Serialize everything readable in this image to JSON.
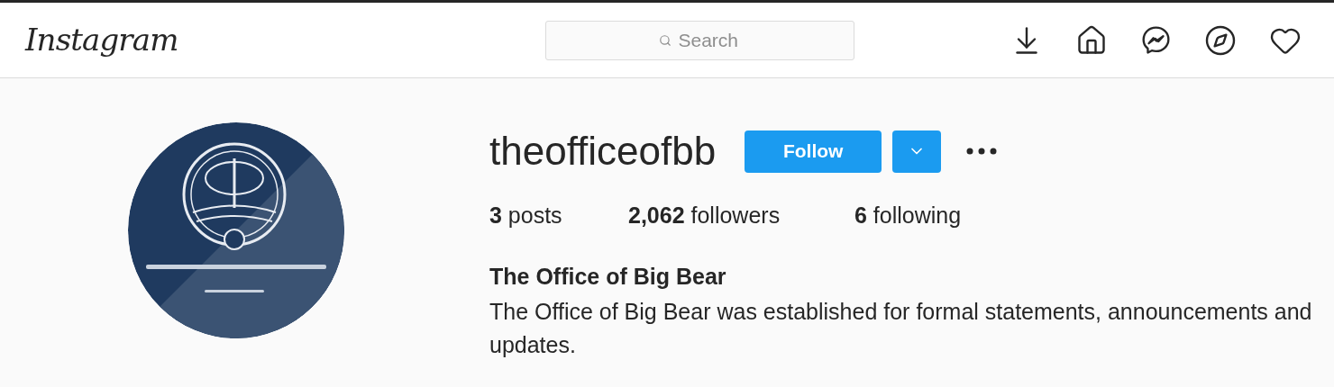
{
  "header": {
    "logo": "Instagram",
    "search": {
      "placeholder": "Search"
    }
  },
  "profile": {
    "username": "theofficeofbb",
    "follow_button": "Follow",
    "stats": [
      {
        "text": "**3** posts"
      },
      {
        "text": "**2,062** followers"
      },
      {
        "text": "**6** following"
      }
    ],
    "full_name": "The Office of Big Bear",
    "bio": "The Office of Big Bear was established for formal statements, announcements and updates."
  }
}
